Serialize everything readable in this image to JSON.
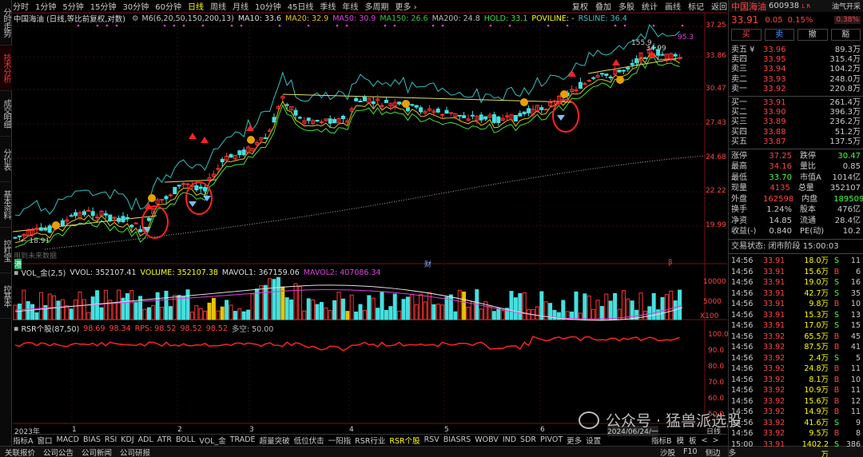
{
  "left_tabs": [
    "分时走势",
    "技术分析",
    "成交明细",
    "分价表",
    "基本资料",
    "控杠宝",
    "控基本"
  ],
  "active_left_tab": 1,
  "periods": [
    "分时",
    "1分钟",
    "5分钟",
    "15分钟",
    "30分钟",
    "60分钟",
    "日线",
    "周线",
    "月线",
    "10分钟",
    "45日线",
    "季线",
    "年线",
    "多周期",
    "更多 ›"
  ],
  "active_period": 6,
  "right_tools": [
    "复权",
    "叠加",
    "多股",
    "统计",
    "画线",
    "标记",
    "返回"
  ],
  "indicators_line": {
    "stock": "中国海油 (日线,等比前复权,对数)",
    "m6": "M6(6,20,50,150,200,13)",
    "ma10": "MA10: 33.6",
    "ma20": "MA20: 32.9",
    "ma50": "MA50: 30.9",
    "ma150": "MA150: 26.6",
    "ma200": "MA200: 24.8",
    "hold": "HOLD: 33.1",
    "poviline": "POVILINE: -",
    "rsline": "RSLINE: 36.4"
  },
  "price_axis": [
    "37.25",
    "33.86",
    "30.47",
    "27.43",
    "24.68",
    "22.22",
    "19.99"
  ],
  "price_annot": {
    "high": "155.9",
    "mid": "34.99",
    "right": "95.3",
    "low": "18.91"
  },
  "watermark_note": "用到未来数据",
  "event_labels": {
    "left": "港",
    "mid": "财",
    "right": "β"
  },
  "vol_line": {
    "name": "VOL_金(2,5)",
    "vvol": "VVOL: 352107.41",
    "volume": "VOLUME: 352107.38",
    "mavol1": "MAVOL1: 367159.06",
    "mavol2": "MAVOL2: 407086.34"
  },
  "vol_axis": [
    "10000",
    "5000",
    "X100"
  ],
  "rsr_line": {
    "name": "RSR个股(87,50)",
    "a": "98.69",
    "b": "98.34",
    "rps": "RPS: 98.52",
    "c": "98.52",
    "d": "98.52",
    "e": "多空: 50.00"
  },
  "rsr_axis": [
    "100.0",
    "90.0",
    "80.0",
    "70.0",
    "60.0",
    "50.0"
  ],
  "date_axis": {
    "start": "2023年",
    "months": [
      "1",
      "2",
      "3",
      "4",
      "5",
      "6"
    ],
    "current": "2024/06/24/一",
    "right": "日线"
  },
  "bottom_tabs": [
    "指标A",
    "窗口",
    "MACD",
    "BIAS",
    "RSI",
    "KDJ",
    "ADL",
    "ATR",
    "BOLL",
    "VOL_金",
    "TRADE",
    "超量突破",
    "低位伏击",
    "一阳指",
    "RSR行业",
    "RSR个股",
    "RSV",
    "BIASRS",
    "WOBV",
    "IND",
    "SDR",
    "PIVOT",
    "更多",
    "设置"
  ],
  "active_bottom_tab": 15,
  "bottom_right": [
    "指标B",
    "模",
    "板",
    "<",
    ">"
  ],
  "status_bar": [
    "关联报价",
    "公司公告",
    "公司新闻",
    "公司研报"
  ],
  "status_right": [
    "沙股",
    "F10",
    "侧边",
    "多"
  ],
  "watermark": "公众号 · 猛兽派选股",
  "quote": {
    "name": "中国海油",
    "code": "600938",
    "lr": "L R",
    "sector": "油气开采",
    "sector_pct": "0.38%",
    "price": "33.91",
    "change": "0.05",
    "pct": "0.15%",
    "buttons": [
      "买",
      "卖",
      "撤",
      "豁"
    ],
    "asks": [
      {
        "l": "卖五 ¥",
        "p": "33.96",
        "v": "89.3万"
      },
      {
        "l": "卖四",
        "p": "33.95",
        "v": "315.4万"
      },
      {
        "l": "卖三",
        "p": "33.94",
        "v": "104.2万"
      },
      {
        "l": "卖二",
        "p": "33.93",
        "v": "248.0万"
      },
      {
        "l": "卖一",
        "p": "33.92",
        "v": "220.8万"
      }
    ],
    "bids": [
      {
        "l": "买一",
        "p": "33.91",
        "v": "261.4万"
      },
      {
        "l": "买二",
        "p": "33.90",
        "v": "396.3万"
      },
      {
        "l": "买三",
        "p": "33.89",
        "v": "236.2万"
      },
      {
        "l": "买四",
        "p": "33.88",
        "v": "51.2万"
      },
      {
        "l": "买五",
        "p": "33.87",
        "v": "137.5万"
      }
    ],
    "fields": [
      [
        "涨停",
        "37.25",
        "跌停",
        "30.47"
      ],
      [
        "最高",
        "34.16",
        "量比",
        "0.85"
      ],
      [
        "最低",
        "33.70",
        "市值A",
        "1014亿"
      ],
      [
        "现量",
        "4135",
        "总量",
        "352107"
      ],
      [
        "外盘",
        "162598",
        "内盘",
        "189509"
      ],
      [
        "换手",
        "1.24%",
        "股本",
        "476亿"
      ],
      [
        "净资",
        "14.85",
        "流通",
        "28.4亿"
      ],
      [
        "收益(-)",
        "0.840",
        "PE(动)",
        "10.2"
      ]
    ],
    "status": "交易状态: 闭市阶段 15:00:03",
    "ticks": [
      [
        "14:56",
        "33.91",
        "18.0万",
        "S",
        "11"
      ],
      [
        "14:56",
        "33.91",
        "15.6万",
        "B",
        "6"
      ],
      [
        "14:56",
        "33.91",
        "19.0万",
        "S",
        "16"
      ],
      [
        "14:56",
        "33.91",
        "42.7万",
        "S",
        "35"
      ],
      [
        "14:56",
        "33.91",
        "9.8万",
        "B",
        "10"
      ],
      [
        "14:56",
        "33.91",
        "15.3万",
        "S",
        "13"
      ],
      [
        "14:56",
        "33.91",
        "17.0万",
        "S",
        "15"
      ],
      [
        "14:56",
        "33.92",
        "65.5万",
        "B",
        "45"
      ],
      [
        "14:56",
        "33.92",
        "87.5万",
        "B",
        "41"
      ],
      [
        "14:56",
        "33.92",
        "2.4万",
        "S",
        "5"
      ],
      [
        "14:56",
        "33.92",
        "24.8万",
        "B",
        "11"
      ],
      [
        "14:56",
        "33.92",
        "8.1万",
        "B",
        "10"
      ],
      [
        "14:56",
        "33.92",
        "10.9万",
        "B",
        "11"
      ],
      [
        "14:56",
        "33.92",
        "15.6万",
        "B",
        "12"
      ],
      [
        "14:56",
        "33.92",
        "14.9万",
        "B",
        "11"
      ],
      [
        "14:56",
        "33.92",
        "41.6万",
        "S",
        "9"
      ],
      [
        "14:56",
        "33.92",
        "9.5万",
        "B",
        "8"
      ],
      [
        "15:00",
        "33.91",
        "1402.2万",
        "S",
        "386"
      ]
    ]
  }
}
